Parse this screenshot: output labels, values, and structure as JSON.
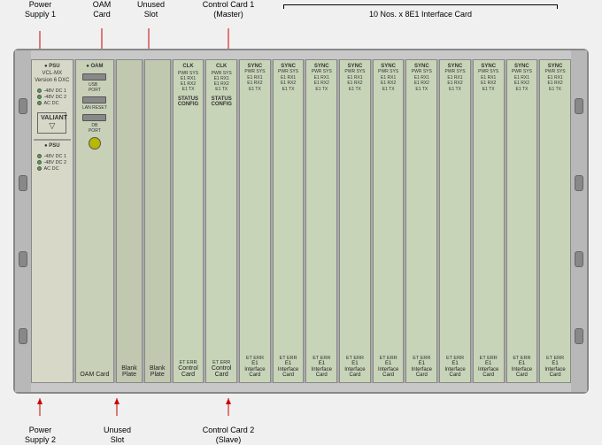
{
  "labels": {
    "power_supply_1": "Power\nSupply 1",
    "oam_card": "OAM\nCard",
    "unused_slot": "Unused\nSlot",
    "control_card_1": "Control Card 1\n(Master)",
    "ten_nos_label": "10 Nos. x 8E1 Interface Card",
    "power_supply_2": "Power\nSupply 2",
    "unused_slot_2": "Unused\nSlot",
    "control_card_2": "Control Card 2\n(Slave)"
  },
  "chassis": {
    "psu1": {
      "brand": "VALIANT",
      "model": "VCL-MX\nVersion 6\nDXC",
      "leds": [
        {
          "color": "green",
          "label": "PSU"
        },
        {
          "color": "green",
          "label": "-48V DC 1"
        },
        {
          "color": "green",
          "label": "-48V DC 2"
        },
        {
          "color": "green",
          "label": "AC DC"
        }
      ],
      "slot_label": "Power\nSupply 1"
    },
    "oam": {
      "label": "OAM",
      "slot_label": "OAM\nCard"
    },
    "blank1": {
      "label": "Blank\nPlate",
      "slot_label": ""
    },
    "blank2": {
      "label": "Blank\nPlate",
      "slot_label": ""
    },
    "control1": {
      "label": "Control\nCard",
      "slot_label": "Control\nCard"
    },
    "control2": {
      "label": "Control\nCard",
      "slot_label": "Control\nCard"
    },
    "e1_cards": [
      "E1 Interface\nCard",
      "E1 Interface\nCard",
      "E1 Interface\nCard",
      "E1 Interface\nCard",
      "E1 Interface\nCard",
      "E1 Interface\nCard",
      "E1 Interface\nCard",
      "E1 Interface\nCard",
      "E1 Interface\nCard",
      "E1 Interface\nCard"
    ],
    "psu2": {
      "leds": [
        {
          "color": "green",
          "label": "-48V DC 1"
        },
        {
          "color": "green",
          "label": "-48V DC 2"
        },
        {
          "color": "green",
          "label": "AC DC"
        }
      ],
      "slot_label": "Power\nSupply 2"
    }
  }
}
